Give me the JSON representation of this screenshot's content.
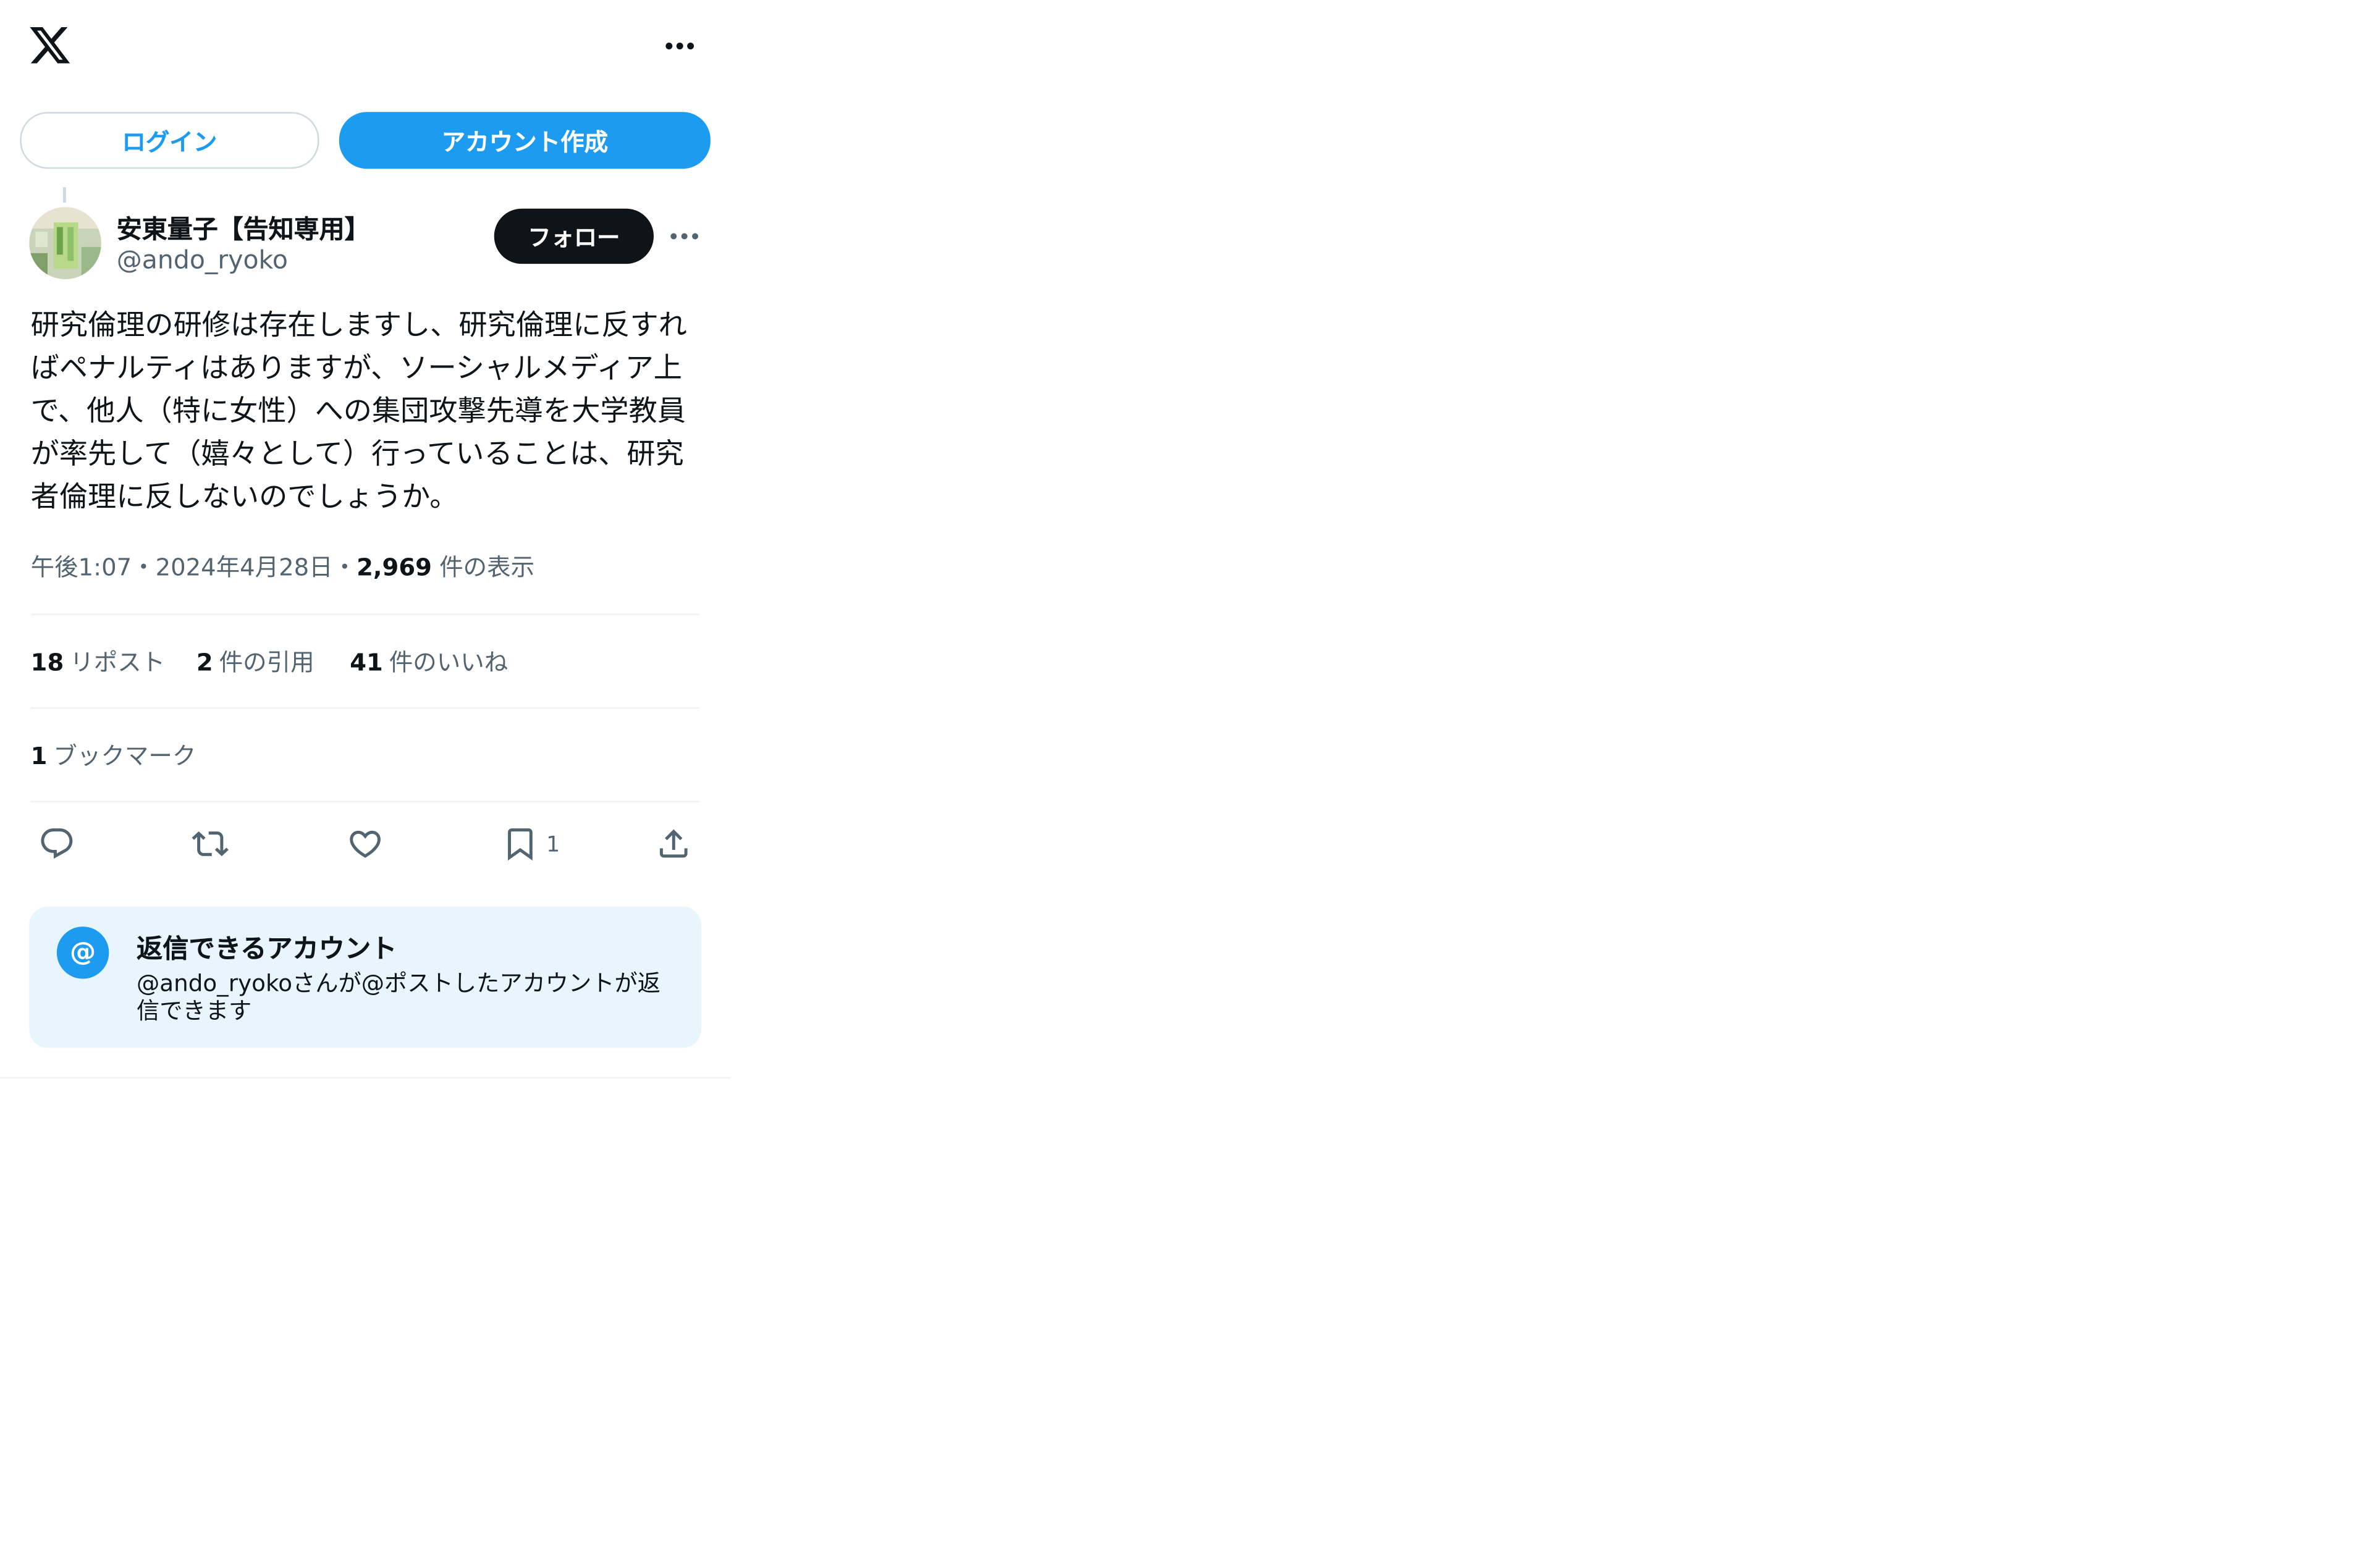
{
  "header": {
    "logo_icon": "x-logo-icon",
    "more_icon": "more-horizontal-icon"
  },
  "auth": {
    "login_label": "ログイン",
    "signup_label": "アカウント作成"
  },
  "author": {
    "display_name": "安東量子【告知専用】",
    "handle": "@ando_ryoko",
    "follow_label": "フォロー"
  },
  "tweet": {
    "text": "研究倫理の研修は存在しますし、研究倫理に反すればペナルティはありますが、ソーシャルメディア上で、他人（特に女性）への集団攻撃先導を大学教員が率先して（嬉々として）行っていることは、研究者倫理に反しないのでしょうか。",
    "time": "午後1:07",
    "sep1": "・",
    "date": "2024年4月28日",
    "sep2": "・",
    "views_count": "2,969",
    "views_label": " 件の表示"
  },
  "stats": {
    "reposts_count": "18",
    "reposts_label": "リポスト",
    "quotes_count": "2",
    "quotes_label": "件の引用",
    "likes_count": "41",
    "likes_label": "件のいいね",
    "bookmarks_count": "1",
    "bookmarks_label": "ブックマーク"
  },
  "actions": {
    "reply_icon": "reply-icon",
    "repost_icon": "repost-icon",
    "like_icon": "like-icon",
    "bookmark_icon": "bookmark-icon",
    "bookmark_count": "1",
    "share_icon": "share-icon"
  },
  "reply_restriction": {
    "badge": "@",
    "title": "返信できるアカウント",
    "description": "@ando_ryokoさんが@ポストしたアカウントが返信できます"
  },
  "colors": {
    "accent": "#1d9bf0",
    "text_primary": "#0f1419",
    "text_secondary": "#536471",
    "reply_box_bg": "#e8f5fd"
  }
}
